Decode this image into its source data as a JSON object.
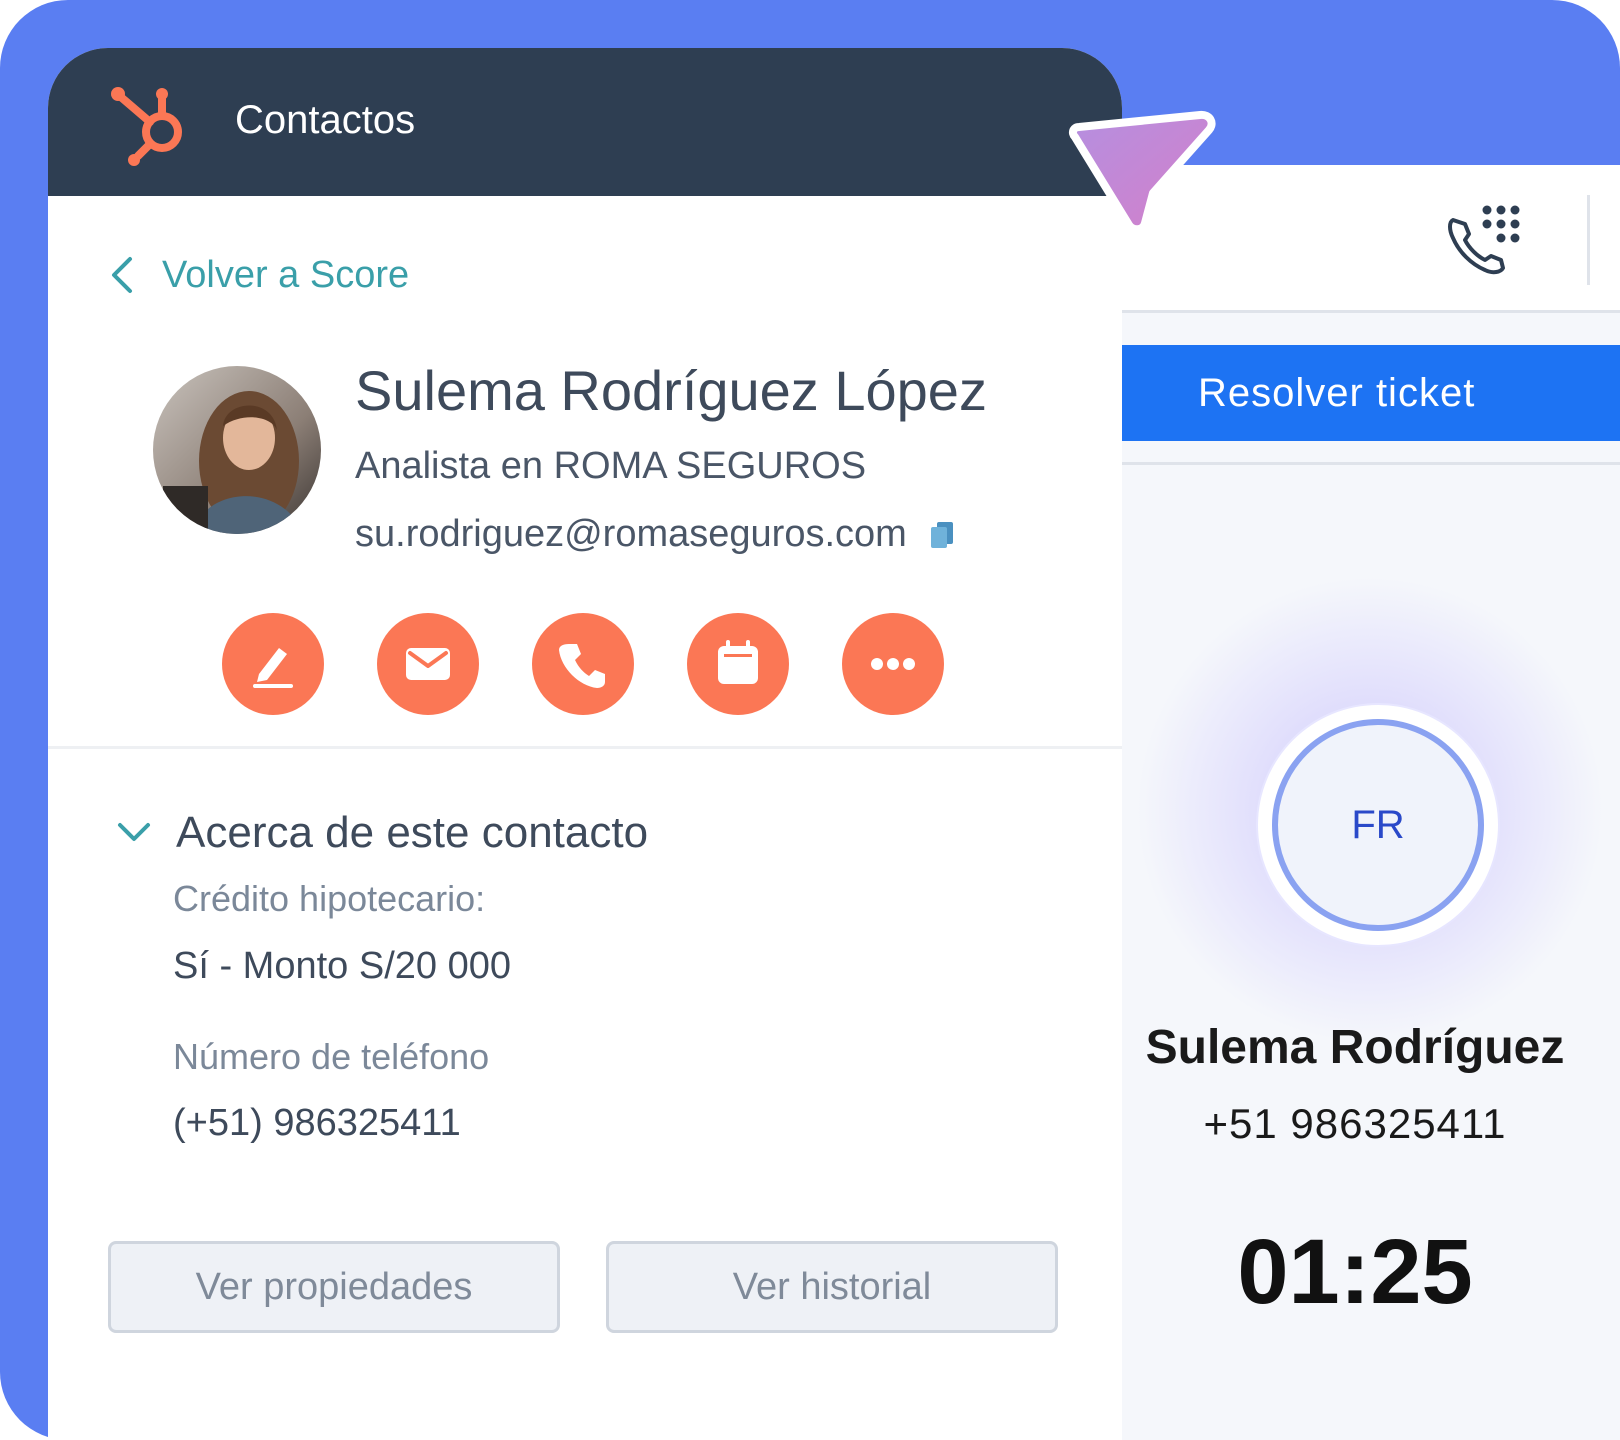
{
  "header": {
    "title": "Contactos"
  },
  "back_link": {
    "label": "Volver a Score"
  },
  "contact": {
    "name": "Sulema Rodríguez López",
    "role": "Analista en ROMA SEGUROS",
    "email": "su.rodriguez@romaseguros.com"
  },
  "actions": [
    {
      "icon": "pencil-icon"
    },
    {
      "icon": "envelope-icon"
    },
    {
      "icon": "phone-icon"
    },
    {
      "icon": "calendar-icon"
    },
    {
      "icon": "more-icon"
    }
  ],
  "about": {
    "title": "Acerca de este contacto",
    "properties": [
      {
        "label": "Crédito hipotecario:",
        "value": "Sí - Monto S/20 000"
      },
      {
        "label": "Número de teléfono",
        "value": "(+51) 986325411"
      }
    ]
  },
  "buttons": {
    "view_properties": "Ver propiedades",
    "view_history": "Ver historial"
  },
  "call": {
    "resolve_label": "Resolver ticket",
    "initials": "FR",
    "caller_name": "Sulema Rodríguez",
    "caller_phone": "+51 986325411",
    "timer": "01:25"
  },
  "colors": {
    "background": "#5a7ef2",
    "header": "#2e3e52",
    "accent_orange": "#fb7755",
    "link_teal": "#3a9fa9",
    "resolve_blue": "#1d73f3",
    "cursor": "#c77fd6"
  }
}
